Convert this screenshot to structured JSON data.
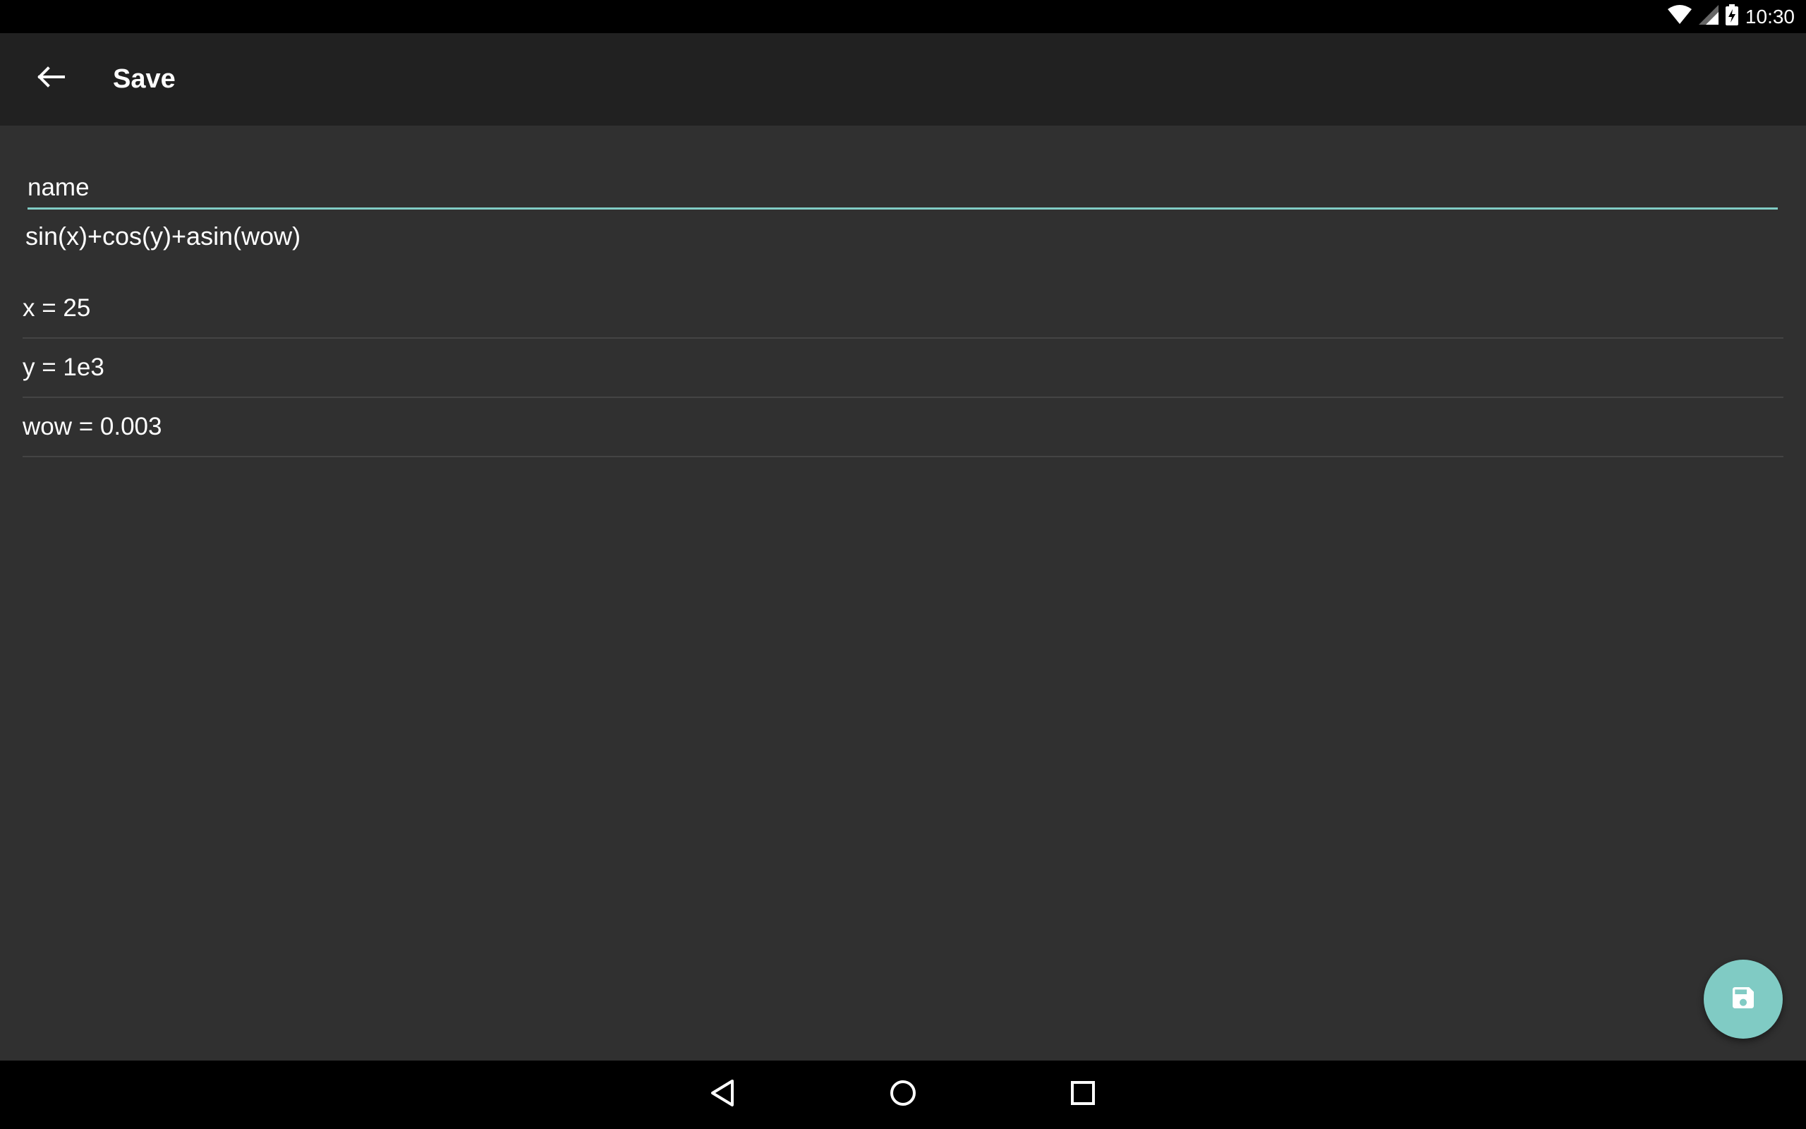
{
  "status_bar": {
    "time": "10:30",
    "icons": [
      "wifi-icon",
      "signal-icon",
      "battery-charging-icon"
    ]
  },
  "app_bar": {
    "back_icon": "arrow-left-icon",
    "title": "Save"
  },
  "form": {
    "name_placeholder": "name",
    "name_value": "",
    "expression": "sin(x)+cos(y)+asin(wow)"
  },
  "variables": [
    {
      "text": "x = 25"
    },
    {
      "text": "y = 1e3"
    },
    {
      "text": "wow = 0.003"
    }
  ],
  "fab": {
    "icon": "save-floppy-icon"
  },
  "nav_bar": {
    "icons": [
      "back-triangle-icon",
      "home-circle-icon",
      "recents-square-icon"
    ]
  },
  "colors": {
    "accent": "#80cbc4",
    "background": "#303030",
    "app_bar": "#212121",
    "system_bars": "#000000"
  }
}
